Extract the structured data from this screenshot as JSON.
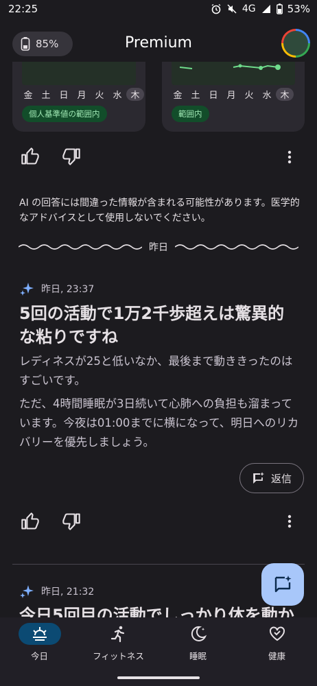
{
  "status_bar": {
    "time": "22:25",
    "network": "4G",
    "battery": "53%"
  },
  "header": {
    "battery_level": "85%",
    "title": "Premium"
  },
  "cards": [
    {
      "days": [
        "金",
        "土",
        "日",
        "月",
        "火",
        "水",
        "木"
      ],
      "badge": "個人基準値の範囲内"
    },
    {
      "days": [
        "金",
        "土",
        "日",
        "月",
        "火",
        "水",
        "木"
      ],
      "badge": "範囲内"
    }
  ],
  "disclaimer": "AI の回答には間違った情報が含まれる可能性があります。医学的なアドバイスとして使用しないでください。",
  "divider_label": "昨日",
  "message1": {
    "time": "昨日, 23:37",
    "headline": "5回の活動で1万2千歩超えは驚異的な粘りですね",
    "paragraphs": [
      "レディネスが25と低いなか、最後まで動ききったのはすごいです。",
      "ただ、4時間睡眠が3日続いて心肺への負担も溜まっています。今夜は01:00までに横になって、明日へのリカバリーを優先しましょう。"
    ],
    "reply_label": "返信"
  },
  "message2": {
    "time": "昨日, 21:32",
    "headline": "今日5回目の活動でしっかり体を動か"
  },
  "nav": [
    {
      "label": "今日",
      "icon": "today-sun-icon",
      "active": true
    },
    {
      "label": "フィットネス",
      "icon": "running-icon",
      "active": false
    },
    {
      "label": "睡眠",
      "icon": "moon-icon",
      "active": false
    },
    {
      "label": "健康",
      "icon": "heart-check-icon",
      "active": false
    }
  ],
  "colors": {
    "background": "#1c1b1f",
    "accent": "#a8c7fa",
    "badge_green": "#124d2a",
    "nav_active": "#0b4a73"
  }
}
